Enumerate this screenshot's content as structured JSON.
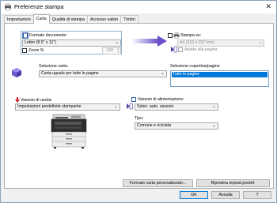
{
  "window": {
    "title": "Preferenze stampa"
  },
  "tabs": [
    {
      "label": "Impostazioni"
    },
    {
      "label": "Carta"
    },
    {
      "label": "Qualità di stampa"
    },
    {
      "label": "Accesso valido"
    },
    {
      "label": "Timbri"
    }
  ],
  "paper": {
    "document_format_label": "Formato documento:",
    "document_format_value": "Letter (8.5\" x 11\")",
    "zoom_label": "Zoom %",
    "zoom_value": "100",
    "print_on_label": "Stampa su:",
    "print_on_value": "A4 (210 x 297 mm)",
    "fit_page_label": "Adatta alla pagina",
    "paper_selection_label": "Selezione carta:",
    "paper_selection_value": "Carta uguale per tutte le pagine",
    "cover_selection_label": "Selezione copertina/pagine",
    "cover_selection_items": [
      "Tutte le pagine"
    ],
    "output_tray_label": "Vassoio di uscita:",
    "output_tray_value": "Impostazioni predefinite stampante",
    "input_tray_label": "Vassoio di alimentazione:",
    "input_tray_value": "Selez. auto. vassoio",
    "type_label": "Tipo:",
    "type_value": "Comune e riciclata"
  },
  "buttons": {
    "custom_paper_size": "Formato carta personalizzato...",
    "restore_defaults": "Ripristina impost.predef.",
    "ok": "OK",
    "cancel": "Annulla",
    "help": "?"
  },
  "colors": {
    "accent": "#0078d7",
    "arrow": "#6a4fc8",
    "output_tray_icon": "#d42020",
    "frame": "#8ab4d8"
  }
}
